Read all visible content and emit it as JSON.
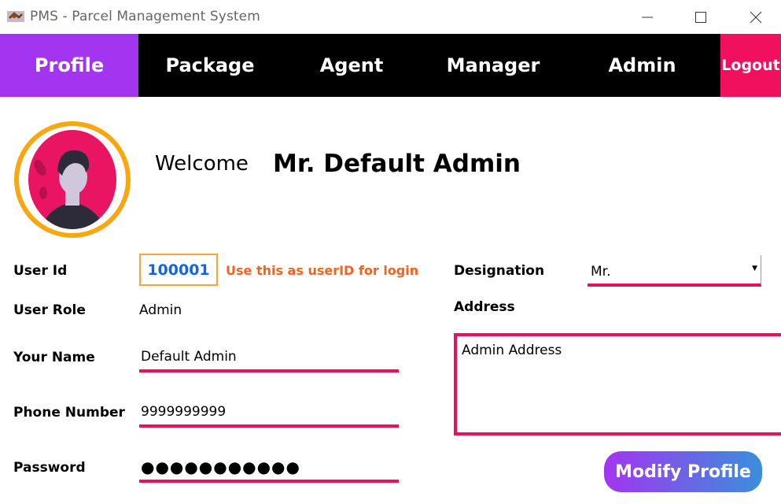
{
  "window": {
    "title": "PMS - Parcel Management System",
    "icons": [
      "app-icon",
      "minimize-icon",
      "maximize-icon",
      "close-icon"
    ]
  },
  "nav": {
    "profile": "Profile",
    "package": "Package",
    "agent": "Agent",
    "manager": "Manager",
    "admin": "Admin",
    "logout": "Logout",
    "active": "Profile"
  },
  "welcome": {
    "greeting": "Welcome",
    "name": "Mr. Default Admin"
  },
  "form": {
    "user_id_label": "User Id",
    "user_id": "100001",
    "user_id_hint": "Use this as userID for login",
    "role_label": "User Role",
    "role": "Admin",
    "name_label": "Your Name",
    "name": "Default Admin",
    "phone_label": "Phone Number",
    "phone": "9999999999",
    "password_label": "Password",
    "password": "●●●●●●●●●●●",
    "designation_label": "Designation",
    "designation": "Mr.",
    "address_label": "Address",
    "address": "Admin Address",
    "modify_button": "Modify Profile"
  },
  "colors": {
    "accent_purple": "#a335f0",
    "accent_pink": "#e9105e",
    "logout_pink": "#f1105e",
    "userid_border": "#f4a63a",
    "userid_text": "#1565e0",
    "hint_orange": "#f2641e",
    "avatar_ring": "#f8a70f"
  }
}
